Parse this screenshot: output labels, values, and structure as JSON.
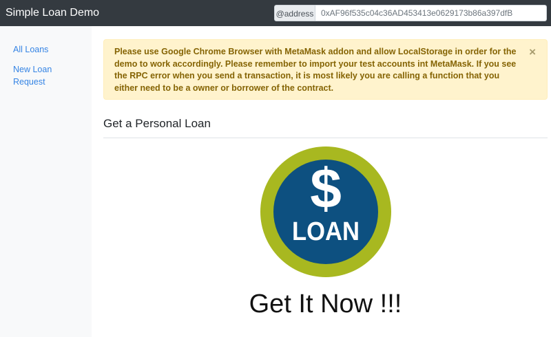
{
  "navbar": {
    "brand": "Simple Loan Demo",
    "address_prefix": "@address",
    "address_value": "0xAF96f535c04c36AD453413e0629173b86a397dfB"
  },
  "sidebar": {
    "items": [
      {
        "label": "All Loans"
      },
      {
        "label": "New Loan Request"
      }
    ]
  },
  "alert": {
    "message": "Please use Google Chrome Browser with MetaMask addon and allow LocalStorage in order for the demo to work accordingly. Please remember to import your test accounts int MetaMask. If you see the RPC error when you send a transaction, it is most likely you are calling a function that you either need to be a owner or borrower of the contract.",
    "close_glyph": "×"
  },
  "main": {
    "title": "Get a Personal Loan",
    "logo": {
      "symbol": "$",
      "text": "LOAN",
      "ring_color": "#a8b820",
      "inner_color": "#0d5080"
    },
    "cta": "Get It Now !!!"
  },
  "colors": {
    "navbar_bg": "#343a40",
    "sidebar_bg": "#f8f9fa",
    "link": "#3584e4",
    "alert_bg": "#fff3cd",
    "alert_text": "#856404"
  }
}
